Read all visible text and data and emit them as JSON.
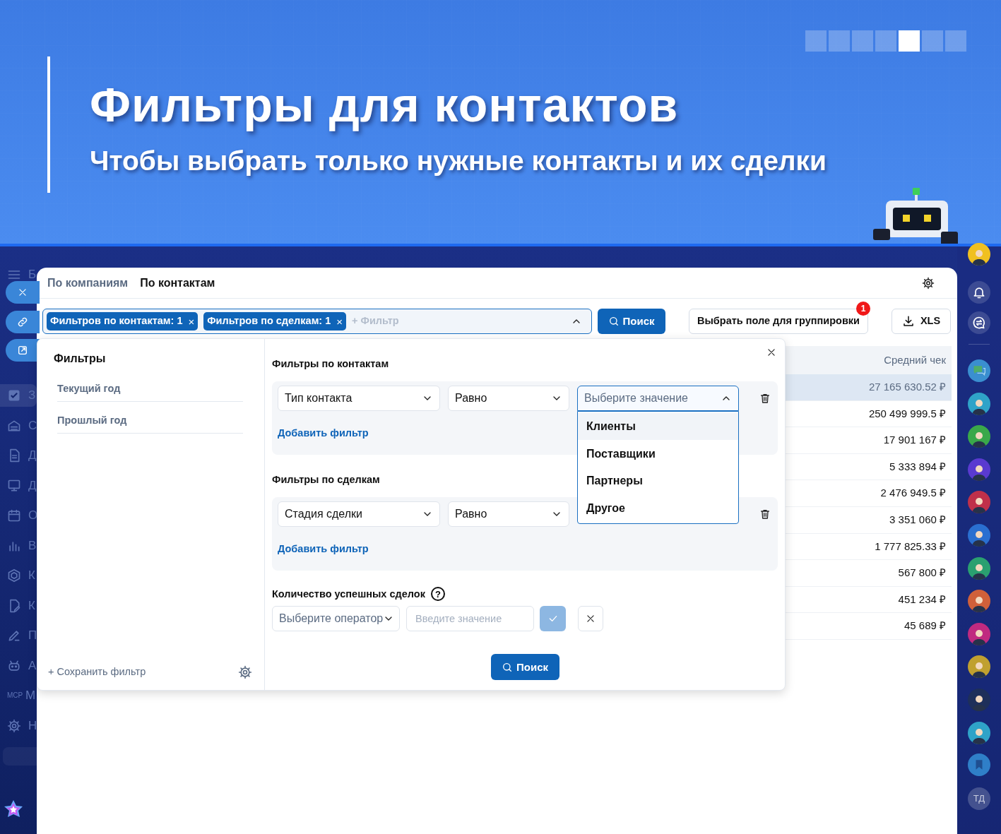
{
  "banner": {
    "title": "Фильтры для контактов",
    "subtitle": "Чтобы выбрать только нужные контакты и их сделки",
    "slides": [
      {
        "selected": false
      },
      {
        "selected": false
      },
      {
        "selected": false
      },
      {
        "selected": false
      },
      {
        "selected": true
      },
      {
        "selected": false
      },
      {
        "selected": false
      }
    ]
  },
  "left_nav": {
    "top_label": "Б",
    "items": [
      {
        "kind": "icon",
        "label": "З",
        "selected": true
      },
      {
        "kind": "icon",
        "label": "С",
        "selected": false
      },
      {
        "kind": "icon",
        "label": "Д",
        "selected": false
      },
      {
        "kind": "icon",
        "label": "Д",
        "selected": false
      },
      {
        "kind": "icon",
        "label": "О",
        "selected": false
      },
      {
        "kind": "icon",
        "label": "В",
        "selected": false
      },
      {
        "kind": "icon",
        "label": "К",
        "selected": false
      },
      {
        "kind": "icon",
        "label": "К",
        "selected": false
      },
      {
        "kind": "icon",
        "label": "П",
        "selected": false
      },
      {
        "kind": "icon",
        "label": "А",
        "selected": false
      },
      {
        "kind": "text_icon",
        "icon_text": "MCP",
        "label": "М",
        "selected": false
      },
      {
        "kind": "icon",
        "label": "Н",
        "selected": false
      }
    ]
  },
  "tabs": [
    {
      "label": "По компаниям",
      "selected": false
    },
    {
      "label": "По контактам",
      "selected": true
    }
  ],
  "toolbar": {
    "chips": [
      {
        "label": "Фильтров по контактам: 1",
        "remove": "×"
      },
      {
        "label": "Фильтров по сделкам: 1",
        "remove": "×"
      }
    ],
    "filter_placeholder": "+ Фильтр",
    "expanded": true,
    "search_button": "Поиск",
    "group_button": "Выбрать поле для группировки",
    "group_badge": "1",
    "export_button": "XLS"
  },
  "table": {
    "header": "Средний чек",
    "rows": [
      {
        "value": "27 165 630.52 ₽",
        "selected": true
      },
      {
        "value": "250 499 999.5 ₽",
        "selected": false
      },
      {
        "value": "17 901 167 ₽",
        "selected": false
      },
      {
        "value": "5 333 894 ₽",
        "selected": false
      },
      {
        "value": "2 476 949.5 ₽",
        "selected": false
      },
      {
        "value": "3 351 060 ₽",
        "selected": false
      },
      {
        "value": "1 777 825.33 ₽",
        "selected": false
      },
      {
        "value": "567 800 ₽",
        "selected": false
      },
      {
        "value": "451 234 ₽",
        "selected": false
      },
      {
        "value": "45 689 ₽",
        "selected": false
      }
    ]
  },
  "filter_panel": {
    "title": "Фильтры",
    "presets": [
      "Текущий год",
      "Прошлый год"
    ],
    "save_button": "+ Сохранить фильтр",
    "groups": [
      {
        "title": "Фильтры по контактам",
        "field": "Тип контакта",
        "operator": "Равно",
        "value_placeholder": "Выберите значение",
        "expanded": true,
        "options": [
          {
            "label": "Клиенты",
            "highlighted": true
          },
          {
            "label": "Поставщики",
            "highlighted": false
          },
          {
            "label": "Партнеры",
            "highlighted": false
          },
          {
            "label": "Другое",
            "highlighted": false
          }
        ],
        "add_link": "Добавить фильтр"
      },
      {
        "title": "Фильтры по сделкам",
        "field": "Стадия сделки",
        "operator": "Равно",
        "add_link": "Добавить фильтр"
      }
    ],
    "count": {
      "label": "Количество успешных сделок",
      "help": "?",
      "operator_placeholder": "Выберите оператор",
      "value_placeholder": "Введите значение",
      "confirm_disabled": true
    },
    "search_button": "Поиск"
  },
  "right_nav": {
    "avatars": [
      {
        "color": "#2fa3c8"
      },
      {
        "color": "#3aa84a"
      },
      {
        "color": "#5a3ad0"
      },
      {
        "color": "#c0304a"
      },
      {
        "color": "#2a6fd0"
      },
      {
        "color": "#2aa070"
      },
      {
        "color": "#d0603a"
      },
      {
        "color": "#c02a80"
      },
      {
        "color": "#c0a030"
      },
      {
        "color": "#1e2f5a"
      },
      {
        "color": "#2fa3c8"
      }
    ],
    "user_initials": "ТД"
  }
}
